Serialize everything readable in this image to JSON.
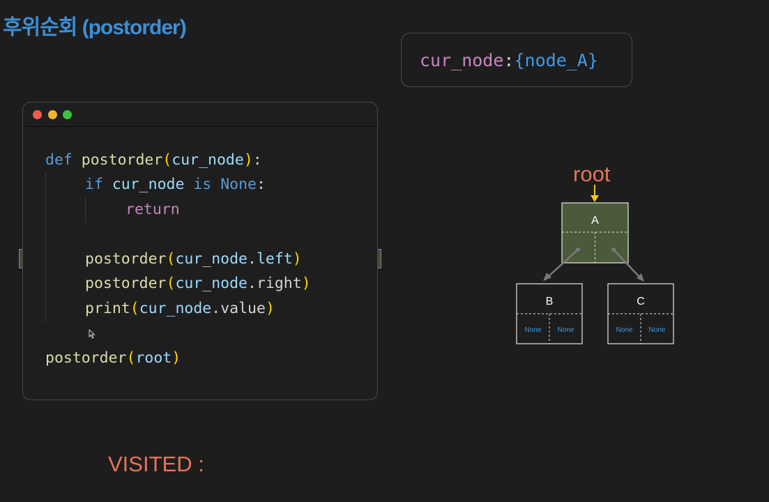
{
  "title": "후위순회 (postorder)",
  "current_var": {
    "name": "cur_node",
    "colon": ":",
    "open": "{",
    "value": "node_A",
    "close": "}"
  },
  "code": {
    "l1": {
      "def": "def",
      "fn": "postorder",
      "open": "(",
      "arg": "cur_node",
      "close": ")",
      "colon": ":"
    },
    "l2": {
      "if": "if",
      "id": "cur_node",
      "is": "is",
      "none": "None",
      "colon": ":"
    },
    "l3": {
      "ret": "return"
    },
    "l4": {
      "fn": "postorder",
      "open": "(",
      "obj": "cur_node",
      "dot": ".",
      "attr": "left",
      "close": ")"
    },
    "l5": {
      "fn": "postorder",
      "open": "(",
      "obj": "cur_node",
      "dot": ".",
      "attr": "right",
      "close": ")"
    },
    "l6": {
      "fn": "print",
      "open": "(",
      "obj": "cur_node",
      "dot": ".",
      "attr": "value",
      "close": ")"
    },
    "l7": {
      "fn": "postorder",
      "open": "(",
      "arg": "root",
      "close": ")"
    },
    "highlighted_line": 4
  },
  "visited_label": "VISITED :",
  "tree": {
    "root_label": "root",
    "nodes": {
      "A": {
        "label": "A",
        "left": "",
        "right": ""
      },
      "B": {
        "label": "B",
        "left": "None",
        "right": "None"
      },
      "C": {
        "label": "C",
        "left": "None",
        "right": "None"
      }
    },
    "current": "A"
  },
  "colors": {
    "background": "#1d1d1d",
    "title": "#3d8fd6",
    "accent_orange": "#e8745a",
    "active_node_fill": "#4a5a3a",
    "none_text": "#3d9be9"
  }
}
